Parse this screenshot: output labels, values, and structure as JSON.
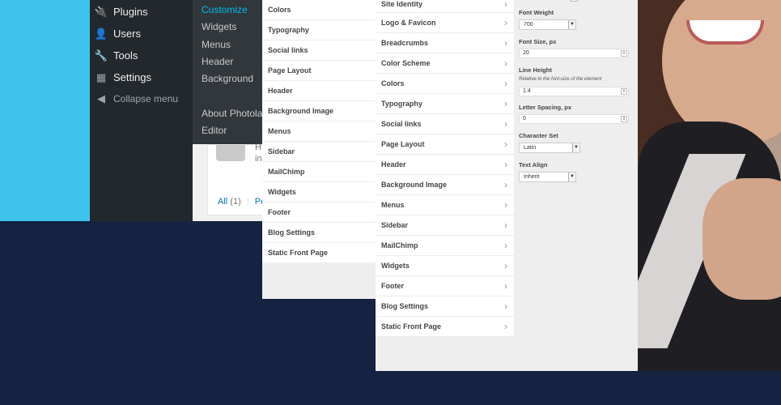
{
  "admin_menu": {
    "items": [
      {
        "label": "Plugins",
        "icon": "plugin-icon"
      },
      {
        "label": "Users",
        "icon": "users-icon"
      },
      {
        "label": "Tools",
        "icon": "wrench-icon"
      },
      {
        "label": "Settings",
        "icon": "settings-icon"
      }
    ],
    "collapse_label": "Collapse menu"
  },
  "appearance_submenu": {
    "items": [
      "Customize",
      "Widgets",
      "Menus",
      "Header",
      "Background",
      "About Photolab",
      "Editor"
    ]
  },
  "comments_box": {
    "excerpt_line1": "H",
    "excerpt_line2": "in",
    "filter_all": "All",
    "filter_all_count": "(1)",
    "filter_pending": "Pen"
  },
  "customizer_a": {
    "sections": [
      "Colors",
      "Typography",
      "Social links",
      "Page Layout",
      "Header",
      "Background Image",
      "Menus",
      "Sidebar",
      "MailChimp",
      "Widgets",
      "Footer",
      "Blog Settings",
      "Static Front Page"
    ]
  },
  "customizer_b": {
    "sections": [
      "Site Identity",
      "Logo & Favicon",
      "Breadcrumbs",
      "Color Scheme",
      "Colors",
      "Typography",
      "Social links",
      "Page Layout",
      "Header",
      "Background Image",
      "Menus",
      "Sidebar",
      "MailChimp",
      "Widgets",
      "Footer",
      "Blog Settings",
      "Static Front Page"
    ]
  },
  "typography_controls": {
    "font_weight_label": "Font Weight",
    "font_weight_value": "700",
    "font_size_label": "Font Size, px",
    "font_size_value": "20",
    "line_height_label": "Line Height",
    "line_height_desc": "Relative to the font-size of the element",
    "line_height_value": "1.4",
    "letter_spacing_label": "Letter Spacing, px",
    "letter_spacing_value": "0",
    "charset_label": "Character Set",
    "charset_value": "Latin",
    "text_align_label": "Text Align",
    "text_align_value": "Inherit"
  },
  "colors": {
    "background_navy": "#152241",
    "cyan": "#3ec3ef",
    "admin_dark": "#23282d",
    "submenu_dark": "#32373c",
    "active_link": "#00b9eb"
  }
}
